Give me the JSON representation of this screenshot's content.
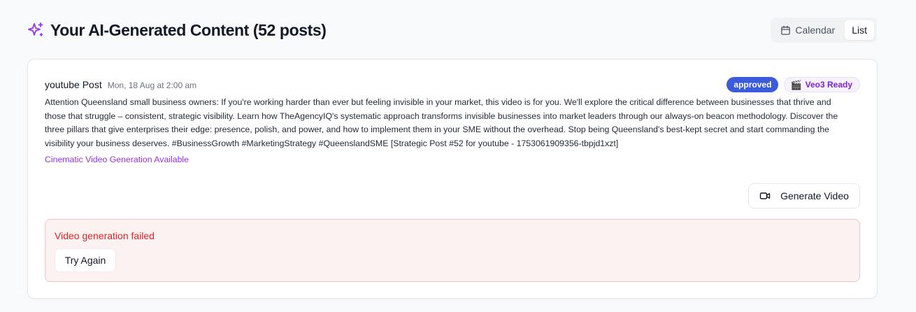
{
  "header": {
    "icon": "sparkles-icon",
    "title": "Your AI-Generated Content (52 posts)",
    "views": [
      {
        "label": "Calendar",
        "icon": "calendar-icon",
        "active": false
      },
      {
        "label": "List",
        "active": true
      }
    ]
  },
  "post": {
    "type": "youtube Post",
    "date": "Mon, 18 Aug at 2:00 am",
    "status_badge": "approved",
    "veo_badge": {
      "icon": "🎬",
      "label": "Veo3 Ready"
    },
    "content": "Attention Queensland small business owners: If you're working harder than ever but feeling invisible in your market, this video is for you. We'll explore the critical difference between businesses that thrive and those that struggle – consistent, strategic visibility. Learn how TheAgencyIQ's systematic approach transforms invisible businesses into market leaders through our always-on beacon methodology. Discover the three pillars that give enterprises their edge: presence, polish, and power, and how to implement them in your SME without the overhead. Stop being Queensland's best-kept secret and start commanding the visibility your business deserves. #BusinessGrowth #MarketingStrategy #QueenslandSME [Strategic Post #52 for youtube - 1753061909356-tbpjd1xzt]",
    "cinematic_link": "Cinematic Video Generation Available",
    "generate_button": {
      "label": "Generate Video",
      "icon": "video-camera-icon"
    },
    "error": {
      "message": "Video generation failed",
      "retry_label": "Try Again"
    }
  },
  "colors": {
    "accent_purple": "#9333ea",
    "approved_blue": "#3b5bdb",
    "error_red": "#dc2626",
    "error_bg": "#fdf2f2"
  }
}
